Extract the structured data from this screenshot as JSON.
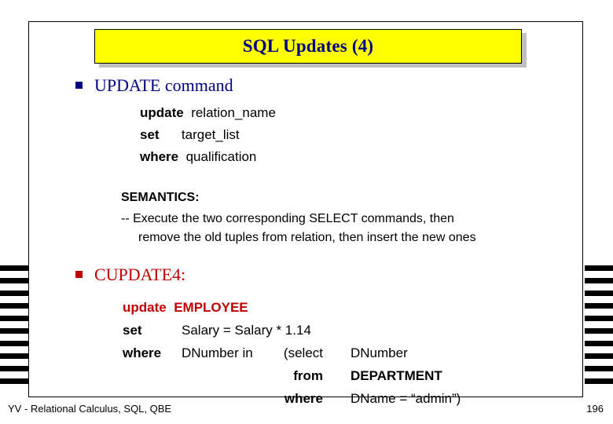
{
  "slide": {
    "title": "SQL Updates (4)",
    "bullets": [
      {
        "label": "UPDATE command",
        "color": "#000080"
      },
      {
        "label": "CUPDATE4:",
        "color": "#c00000"
      }
    ],
    "syntax": [
      {
        "keyword": "update",
        "argument": "relation_name"
      },
      {
        "keyword": "set",
        "argument": "target_list"
      },
      {
        "keyword": "where",
        "argument": "qualification"
      }
    ],
    "semantics": {
      "heading": "SEMANTICS:",
      "line1": "-- Execute the two corresponding SELECT commands, then",
      "line2": "remove the old tuples from relation, then insert the new ones"
    },
    "example": {
      "update_kw": "update",
      "update_target": "EMPLOYEE",
      "set_kw": "set",
      "set_expr": "Salary = Salary * 1.14",
      "where_kw": "where",
      "where_expr": "DNumber in",
      "subquery_open": "(select",
      "subquery_select": "DNumber",
      "subquery_from_kw": "from",
      "subquery_from": "DEPARTMENT",
      "subquery_where_kw": "where",
      "subquery_where": "DName = “admin”)"
    }
  },
  "footer": {
    "left": "YV  -  Relational Calculus, SQL, QBE",
    "page": "196"
  },
  "colors": {
    "title_bg": "#ffff00",
    "title_text": "#000080",
    "accent_red": "#c00000",
    "accent_navy": "#000080"
  }
}
